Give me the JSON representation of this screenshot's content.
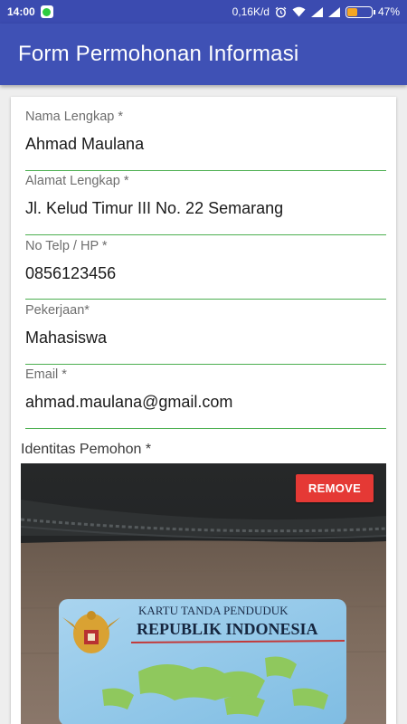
{
  "status_bar": {
    "time": "14:00",
    "network_speed": "0,16K/d",
    "battery_percent": "47%",
    "battery_level": 0.47,
    "icons": [
      "whatsapp-icon",
      "alarm-icon",
      "wifi-icon",
      "signal-icon",
      "signal-icon",
      "battery-icon"
    ]
  },
  "app_bar": {
    "title": "Form Permohonan Informasi"
  },
  "form": {
    "fields": [
      {
        "label": "Nama Lengkap *",
        "value": "Ahmad Maulana"
      },
      {
        "label": "Alamat Lengkap *",
        "value": "Jl. Kelud Timur III No. 22 Semarang"
      },
      {
        "label": "No Telp / HP *",
        "value": "0856123456"
      },
      {
        "label": "Pekerjaan*",
        "value": "Mahasiswa"
      },
      {
        "label": "Email *",
        "value": "ahmad.maulana@gmail.com"
      }
    ],
    "identity_label": "Identitas Pemohon *",
    "remove_label": "REMOVE",
    "ktp": {
      "line1": "KARTU TANDA PENDUDUK",
      "line2": "REPUBLIK INDONESIA"
    }
  },
  "colors": {
    "app_bar": "#3f51b5",
    "status_bar": "#3b4bb0",
    "underline": "#4caf50",
    "remove": "#e53935"
  }
}
